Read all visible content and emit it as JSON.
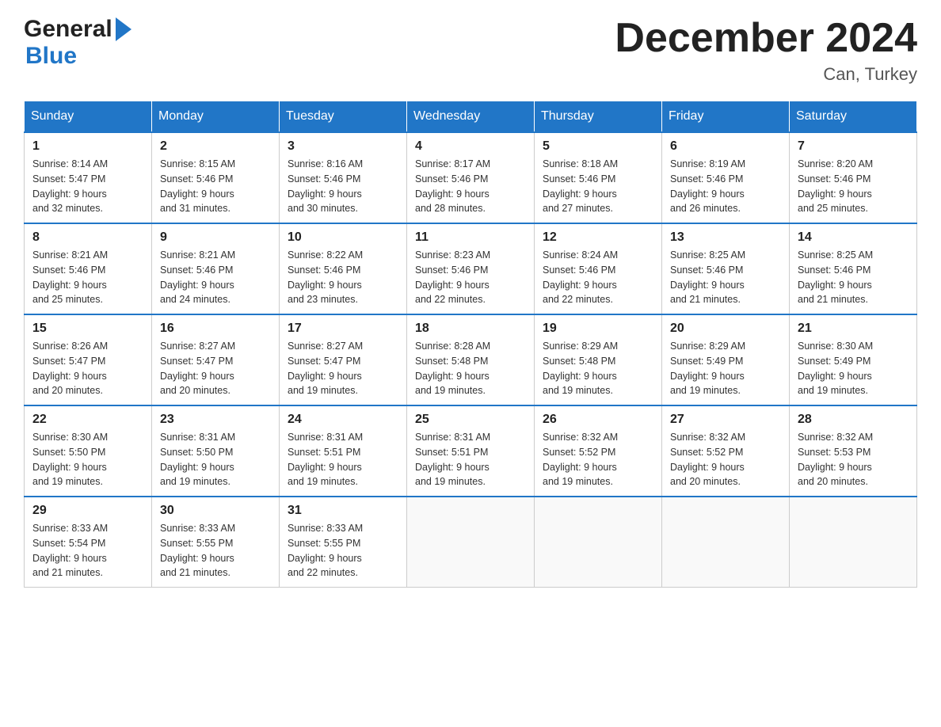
{
  "header": {
    "logo_general": "General",
    "logo_blue": "Blue",
    "month_title": "December 2024",
    "location": "Can, Turkey"
  },
  "days_of_week": [
    "Sunday",
    "Monday",
    "Tuesday",
    "Wednesday",
    "Thursday",
    "Friday",
    "Saturday"
  ],
  "weeks": [
    [
      {
        "day": "1",
        "sunrise": "8:14 AM",
        "sunset": "5:47 PM",
        "daylight": "9 hours and 32 minutes."
      },
      {
        "day": "2",
        "sunrise": "8:15 AM",
        "sunset": "5:46 PM",
        "daylight": "9 hours and 31 minutes."
      },
      {
        "day": "3",
        "sunrise": "8:16 AM",
        "sunset": "5:46 PM",
        "daylight": "9 hours and 30 minutes."
      },
      {
        "day": "4",
        "sunrise": "8:17 AM",
        "sunset": "5:46 PM",
        "daylight": "9 hours and 28 minutes."
      },
      {
        "day": "5",
        "sunrise": "8:18 AM",
        "sunset": "5:46 PM",
        "daylight": "9 hours and 27 minutes."
      },
      {
        "day": "6",
        "sunrise": "8:19 AM",
        "sunset": "5:46 PM",
        "daylight": "9 hours and 26 minutes."
      },
      {
        "day": "7",
        "sunrise": "8:20 AM",
        "sunset": "5:46 PM",
        "daylight": "9 hours and 25 minutes."
      }
    ],
    [
      {
        "day": "8",
        "sunrise": "8:21 AM",
        "sunset": "5:46 PM",
        "daylight": "9 hours and 25 minutes."
      },
      {
        "day": "9",
        "sunrise": "8:21 AM",
        "sunset": "5:46 PM",
        "daylight": "9 hours and 24 minutes."
      },
      {
        "day": "10",
        "sunrise": "8:22 AM",
        "sunset": "5:46 PM",
        "daylight": "9 hours and 23 minutes."
      },
      {
        "day": "11",
        "sunrise": "8:23 AM",
        "sunset": "5:46 PM",
        "daylight": "9 hours and 22 minutes."
      },
      {
        "day": "12",
        "sunrise": "8:24 AM",
        "sunset": "5:46 PM",
        "daylight": "9 hours and 22 minutes."
      },
      {
        "day": "13",
        "sunrise": "8:25 AM",
        "sunset": "5:46 PM",
        "daylight": "9 hours and 21 minutes."
      },
      {
        "day": "14",
        "sunrise": "8:25 AM",
        "sunset": "5:46 PM",
        "daylight": "9 hours and 21 minutes."
      }
    ],
    [
      {
        "day": "15",
        "sunrise": "8:26 AM",
        "sunset": "5:47 PM",
        "daylight": "9 hours and 20 minutes."
      },
      {
        "day": "16",
        "sunrise": "8:27 AM",
        "sunset": "5:47 PM",
        "daylight": "9 hours and 20 minutes."
      },
      {
        "day": "17",
        "sunrise": "8:27 AM",
        "sunset": "5:47 PM",
        "daylight": "9 hours and 19 minutes."
      },
      {
        "day": "18",
        "sunrise": "8:28 AM",
        "sunset": "5:48 PM",
        "daylight": "9 hours and 19 minutes."
      },
      {
        "day": "19",
        "sunrise": "8:29 AM",
        "sunset": "5:48 PM",
        "daylight": "9 hours and 19 minutes."
      },
      {
        "day": "20",
        "sunrise": "8:29 AM",
        "sunset": "5:49 PM",
        "daylight": "9 hours and 19 minutes."
      },
      {
        "day": "21",
        "sunrise": "8:30 AM",
        "sunset": "5:49 PM",
        "daylight": "9 hours and 19 minutes."
      }
    ],
    [
      {
        "day": "22",
        "sunrise": "8:30 AM",
        "sunset": "5:50 PM",
        "daylight": "9 hours and 19 minutes."
      },
      {
        "day": "23",
        "sunrise": "8:31 AM",
        "sunset": "5:50 PM",
        "daylight": "9 hours and 19 minutes."
      },
      {
        "day": "24",
        "sunrise": "8:31 AM",
        "sunset": "5:51 PM",
        "daylight": "9 hours and 19 minutes."
      },
      {
        "day": "25",
        "sunrise": "8:31 AM",
        "sunset": "5:51 PM",
        "daylight": "9 hours and 19 minutes."
      },
      {
        "day": "26",
        "sunrise": "8:32 AM",
        "sunset": "5:52 PM",
        "daylight": "9 hours and 19 minutes."
      },
      {
        "day": "27",
        "sunrise": "8:32 AM",
        "sunset": "5:52 PM",
        "daylight": "9 hours and 20 minutes."
      },
      {
        "day": "28",
        "sunrise": "8:32 AM",
        "sunset": "5:53 PM",
        "daylight": "9 hours and 20 minutes."
      }
    ],
    [
      {
        "day": "29",
        "sunrise": "8:33 AM",
        "sunset": "5:54 PM",
        "daylight": "9 hours and 21 minutes."
      },
      {
        "day": "30",
        "sunrise": "8:33 AM",
        "sunset": "5:55 PM",
        "daylight": "9 hours and 21 minutes."
      },
      {
        "day": "31",
        "sunrise": "8:33 AM",
        "sunset": "5:55 PM",
        "daylight": "9 hours and 22 minutes."
      },
      null,
      null,
      null,
      null
    ]
  ],
  "labels": {
    "sunrise": "Sunrise:",
    "sunset": "Sunset:",
    "daylight": "Daylight:"
  }
}
